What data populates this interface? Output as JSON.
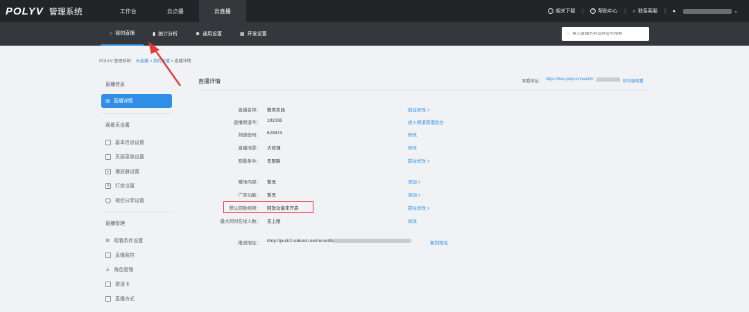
{
  "header": {
    "logo": "POLYV",
    "app_name": "管理系统",
    "nav": [
      "工作台",
      "云点播",
      "云直播"
    ],
    "right": {
      "download": "相关下载",
      "help": "帮助中心",
      "contact": "联系客服"
    }
  },
  "subnav": {
    "items": [
      "我的直播",
      "统计分析",
      "通用设置",
      "开发设置"
    ],
    "search_placeholder": "输入直播名称或频道号搜索"
  },
  "breadcrumb": {
    "root": "POLYV 管理系统",
    "live": "云直播",
    "mine": "我的直播",
    "current": "直播详情"
  },
  "sidebar": {
    "section1": "直播信息",
    "active_item": "直播详情",
    "section2": "观看页设置",
    "items2": [
      "基本信息设置",
      "页面菜单设置",
      "播放器设置",
      "打赏设置",
      "微信分享设置"
    ],
    "section3": "直播管理",
    "items3": [
      "观看条件设置",
      "直播监控",
      "角色管理",
      "邀请卡",
      "直播方式"
    ]
  },
  "main": {
    "title": "直播详情",
    "watch_label": "观看地址：",
    "watch_url": "https://live.polyv.cn/watch/",
    "watch_mobile": "移动端观看",
    "rows": [
      {
        "label": "直播名称：",
        "value": "教育实践",
        "action": "前往修改 >"
      },
      {
        "label": "直播频道号：",
        "value": "191036",
        "action": "进入频道管理后台"
      },
      {
        "label": "频道密码：",
        "value": "629874",
        "action": "修改"
      },
      {
        "label": "直播场景：",
        "value": "大班课",
        "action": "修改"
      },
      {
        "label": "观看条件：",
        "value": "无限制",
        "action": "前往修改 >"
      },
      {
        "label": "暖场内容：",
        "value": "暂无",
        "action": "添加 >"
      },
      {
        "label": "广告功能：",
        "value": "暂无",
        "action": "添加 >"
      },
      {
        "label": "默认回放视频：",
        "value": "回放功能未开启",
        "action": "前往修改 >"
      },
      {
        "label": "最大同时在线人数：",
        "value": "无上限",
        "action": "修改"
      }
    ],
    "stream": {
      "label": "推流地址：",
      "value": "rtmp://push2.videocc.net/recordfe",
      "action": "复制地址"
    }
  }
}
